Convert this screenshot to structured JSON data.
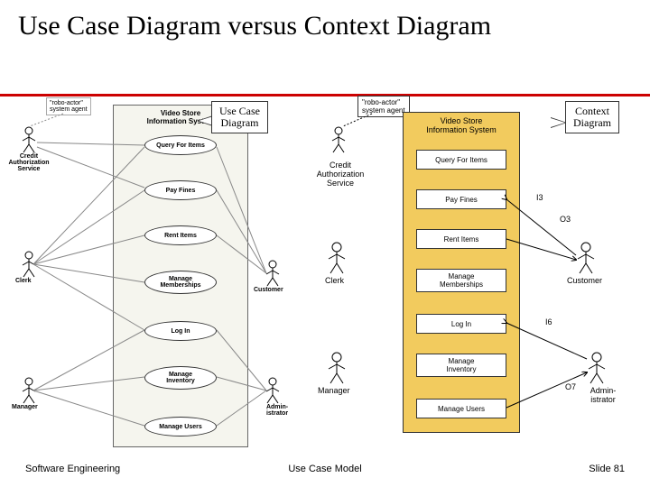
{
  "title": "Use Case Diagram versus Context Diagram",
  "footer": {
    "left": "Software Engineering",
    "center": "Use Case Model",
    "right": "Slide 81"
  },
  "callouts": {
    "usecase": "Use Case\nDiagram",
    "context": "Context\nDiagram"
  },
  "left": {
    "note": "\"robo-actor\"\nsystem agent",
    "system": "Video Store\nInformation System",
    "usecases": [
      "Query For Items",
      "Pay Fines",
      "Rent Items",
      "Manage\nMemberships",
      "Log In",
      "Manage\nInventory",
      "Manage Users"
    ],
    "actors": {
      "credit": "Credit\nAuthorization\nService",
      "clerk": "Clerk",
      "manager": "Manager",
      "customer": "Customer",
      "admin": "Admin-\nistrator"
    }
  },
  "right": {
    "note": "\"robo-actor\"\nsystem agent",
    "system": "Video Store\nInformation System",
    "usecases": [
      "Query For Items",
      "Pay Fines",
      "Rent Items",
      "Manage\nMemberships",
      "Log In",
      "Manage\nInventory",
      "Manage Users"
    ],
    "actors": {
      "credit": "Credit\nAuthorization\nService",
      "clerk": "Clerk",
      "manager": "Manager",
      "customer": "Customer",
      "admin": "Admin-\nistrator"
    },
    "io": {
      "i3": "I3",
      "o3": "O3",
      "i6": "I6",
      "o7": "O7"
    }
  }
}
